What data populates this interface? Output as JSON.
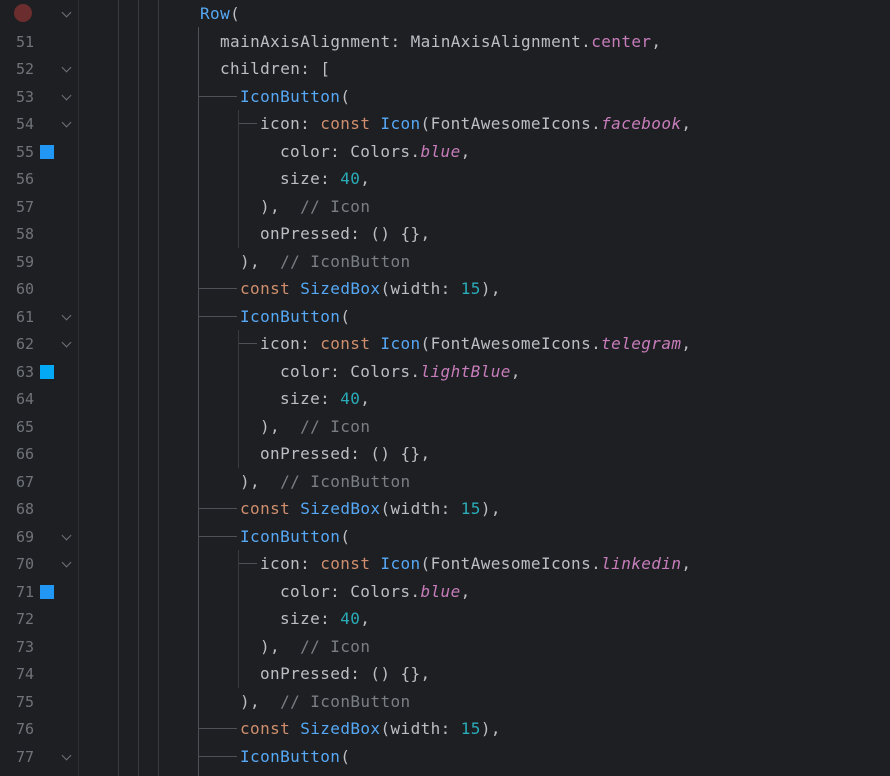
{
  "editor": {
    "breakpoint_color": "#6b2d2d",
    "swatch_colors": {
      "blue": "#2196f3",
      "lightBlue": "#03a9f4"
    },
    "lines": [
      {
        "num": "",
        "indent": 6,
        "fold": true,
        "breakpoint": true,
        "tokens": [
          {
            "t": "Row",
            "c": "cls"
          },
          {
            "t": "(",
            "c": "pln"
          }
        ]
      },
      {
        "num": "51",
        "indent": 7,
        "tokens": [
          {
            "t": "mainAxisAlignment: MainAxisAlignment.",
            "c": "pln"
          },
          {
            "t": "center",
            "c": "fld-plain"
          },
          {
            "t": ",",
            "c": "pln"
          }
        ]
      },
      {
        "num": "52",
        "indent": 7,
        "fold": true,
        "tokens": [
          {
            "t": "children: [",
            "c": "pln"
          }
        ]
      },
      {
        "num": "53",
        "indent": 8,
        "fold": true,
        "hline": true,
        "tokens": [
          {
            "t": "IconButton",
            "c": "cls"
          },
          {
            "t": "(",
            "c": "pln"
          }
        ]
      },
      {
        "num": "54",
        "indent": 9,
        "fold": true,
        "hline": true,
        "tokens": [
          {
            "t": "icon: ",
            "c": "pln"
          },
          {
            "t": "const ",
            "c": "kw"
          },
          {
            "t": "Icon",
            "c": "cls"
          },
          {
            "t": "(FontAwesomeIcons.",
            "c": "pln"
          },
          {
            "t": "facebook",
            "c": "fld"
          },
          {
            "t": ",",
            "c": "pln"
          }
        ]
      },
      {
        "num": "55",
        "indent": 10,
        "swatch": "blue",
        "tokens": [
          {
            "t": "color: Colors.",
            "c": "pln"
          },
          {
            "t": "blue",
            "c": "fld"
          },
          {
            "t": ",",
            "c": "pln"
          }
        ]
      },
      {
        "num": "56",
        "indent": 10,
        "tokens": [
          {
            "t": "size: ",
            "c": "pln"
          },
          {
            "t": "40",
            "c": "num"
          },
          {
            "t": ",",
            "c": "pln"
          }
        ]
      },
      {
        "num": "57",
        "indent": 9,
        "tokens": [
          {
            "t": "),  ",
            "c": "pln"
          },
          {
            "t": "// Icon",
            "c": "cmt"
          }
        ]
      },
      {
        "num": "58",
        "indent": 9,
        "tokens": [
          {
            "t": "onPressed: () {},",
            "c": "pln"
          }
        ]
      },
      {
        "num": "59",
        "indent": 8,
        "tokens": [
          {
            "t": "),  ",
            "c": "pln"
          },
          {
            "t": "// IconButton",
            "c": "cmt"
          }
        ]
      },
      {
        "num": "60",
        "indent": 8,
        "hline": true,
        "tokens": [
          {
            "t": "const ",
            "c": "kw"
          },
          {
            "t": "SizedBox",
            "c": "cls"
          },
          {
            "t": "(width: ",
            "c": "pln"
          },
          {
            "t": "15",
            "c": "num"
          },
          {
            "t": "),",
            "c": "pln"
          }
        ]
      },
      {
        "num": "61",
        "indent": 8,
        "fold": true,
        "hline": true,
        "tokens": [
          {
            "t": "IconButton",
            "c": "cls"
          },
          {
            "t": "(",
            "c": "pln"
          }
        ]
      },
      {
        "num": "62",
        "indent": 9,
        "fold": true,
        "hline": true,
        "tokens": [
          {
            "t": "icon: ",
            "c": "pln"
          },
          {
            "t": "const ",
            "c": "kw"
          },
          {
            "t": "Icon",
            "c": "cls"
          },
          {
            "t": "(FontAwesomeIcons.",
            "c": "pln"
          },
          {
            "t": "telegram",
            "c": "fld"
          },
          {
            "t": ",",
            "c": "pln"
          }
        ]
      },
      {
        "num": "63",
        "indent": 10,
        "swatch": "lightBlue",
        "tokens": [
          {
            "t": "color: Colors.",
            "c": "pln"
          },
          {
            "t": "lightBlue",
            "c": "fld"
          },
          {
            "t": ",",
            "c": "pln"
          }
        ]
      },
      {
        "num": "64",
        "indent": 10,
        "tokens": [
          {
            "t": "size: ",
            "c": "pln"
          },
          {
            "t": "40",
            "c": "num"
          },
          {
            "t": ",",
            "c": "pln"
          }
        ]
      },
      {
        "num": "65",
        "indent": 9,
        "tokens": [
          {
            "t": "),  ",
            "c": "pln"
          },
          {
            "t": "// Icon",
            "c": "cmt"
          }
        ]
      },
      {
        "num": "66",
        "indent": 9,
        "tokens": [
          {
            "t": "onPressed: () {},",
            "c": "pln"
          }
        ]
      },
      {
        "num": "67",
        "indent": 8,
        "tokens": [
          {
            "t": "),  ",
            "c": "pln"
          },
          {
            "t": "// IconButton",
            "c": "cmt"
          }
        ]
      },
      {
        "num": "68",
        "indent": 8,
        "hline": true,
        "tokens": [
          {
            "t": "const ",
            "c": "kw"
          },
          {
            "t": "SizedBox",
            "c": "cls"
          },
          {
            "t": "(width: ",
            "c": "pln"
          },
          {
            "t": "15",
            "c": "num"
          },
          {
            "t": "),",
            "c": "pln"
          }
        ]
      },
      {
        "num": "69",
        "indent": 8,
        "fold": true,
        "hline": true,
        "tokens": [
          {
            "t": "IconButton",
            "c": "cls"
          },
          {
            "t": "(",
            "c": "pln"
          }
        ]
      },
      {
        "num": "70",
        "indent": 9,
        "fold": true,
        "hline": true,
        "tokens": [
          {
            "t": "icon: ",
            "c": "pln"
          },
          {
            "t": "const ",
            "c": "kw"
          },
          {
            "t": "Icon",
            "c": "cls"
          },
          {
            "t": "(FontAwesomeIcons.",
            "c": "pln"
          },
          {
            "t": "linkedin",
            "c": "fld"
          },
          {
            "t": ",",
            "c": "pln"
          }
        ]
      },
      {
        "num": "71",
        "indent": 10,
        "swatch": "blue",
        "tokens": [
          {
            "t": "color: Colors.",
            "c": "pln"
          },
          {
            "t": "blue",
            "c": "fld"
          },
          {
            "t": ",",
            "c": "pln"
          }
        ]
      },
      {
        "num": "72",
        "indent": 10,
        "tokens": [
          {
            "t": "size: ",
            "c": "pln"
          },
          {
            "t": "40",
            "c": "num"
          },
          {
            "t": ",",
            "c": "pln"
          }
        ]
      },
      {
        "num": "73",
        "indent": 9,
        "tokens": [
          {
            "t": "),  ",
            "c": "pln"
          },
          {
            "t": "// Icon",
            "c": "cmt"
          }
        ]
      },
      {
        "num": "74",
        "indent": 9,
        "tokens": [
          {
            "t": "onPressed: () {},",
            "c": "pln"
          }
        ]
      },
      {
        "num": "75",
        "indent": 8,
        "tokens": [
          {
            "t": "),  ",
            "c": "pln"
          },
          {
            "t": "// IconButton",
            "c": "cmt"
          }
        ]
      },
      {
        "num": "76",
        "indent": 8,
        "hline": true,
        "tokens": [
          {
            "t": "const ",
            "c": "kw"
          },
          {
            "t": "SizedBox",
            "c": "cls"
          },
          {
            "t": "(width: ",
            "c": "pln"
          },
          {
            "t": "15",
            "c": "num"
          },
          {
            "t": "),",
            "c": "pln"
          }
        ]
      },
      {
        "num": "77",
        "indent": 8,
        "fold": true,
        "hline": true,
        "tokens": [
          {
            "t": "IconButton",
            "c": "cls"
          },
          {
            "t": "(",
            "c": "pln"
          }
        ]
      }
    ]
  }
}
